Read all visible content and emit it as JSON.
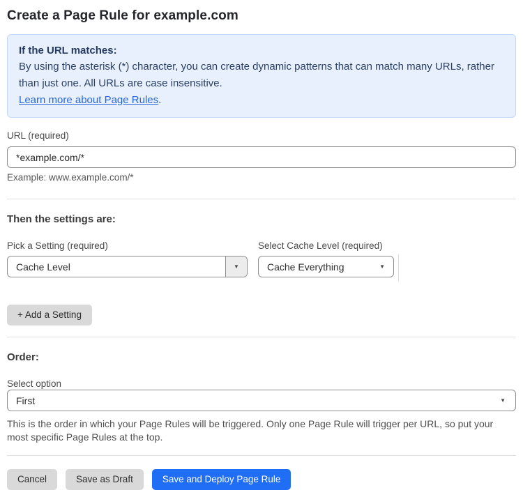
{
  "page": {
    "title": "Create a Page Rule for example.com"
  },
  "info_box": {
    "heading": "If the URL matches:",
    "body": "By using the asterisk (*) character, you can create dynamic patterns that can match many URLs, rather than just one. All URLs are case insensitive.",
    "link_label": "Learn more about Page Rules",
    "link_suffix": "."
  },
  "url_field": {
    "label": "URL (required)",
    "value": "*example.com/*",
    "helper": "Example: www.example.com/*"
  },
  "settings_section": {
    "heading": "Then the settings are:",
    "setting_picker": {
      "label": "Pick a Setting (required)",
      "value": "Cache Level"
    },
    "cache_level_picker": {
      "label": "Select Cache Level (required)",
      "value": "Cache Everything"
    },
    "add_setting_label": "+ Add a Setting"
  },
  "order_section": {
    "heading": "Order:",
    "select_label": "Select option",
    "value": "First",
    "helper": "This is the order in which your Page Rules will be triggered. Only one Page Rule will trigger per URL, so put your most specific Page Rules at the top."
  },
  "footer": {
    "cancel_label": "Cancel",
    "save_draft_label": "Save as Draft",
    "save_deploy_label": "Save and Deploy Page Rule"
  },
  "icons": {
    "dropdown_arrow": "▼"
  },
  "colors": {
    "accent_blue": "#1f6ef5",
    "info_bg": "#e7f0fc",
    "info_border": "#c3daf6",
    "info_text": "#2c4066",
    "link_blue": "#2767d9",
    "button_gray": "#d9d9d9"
  }
}
